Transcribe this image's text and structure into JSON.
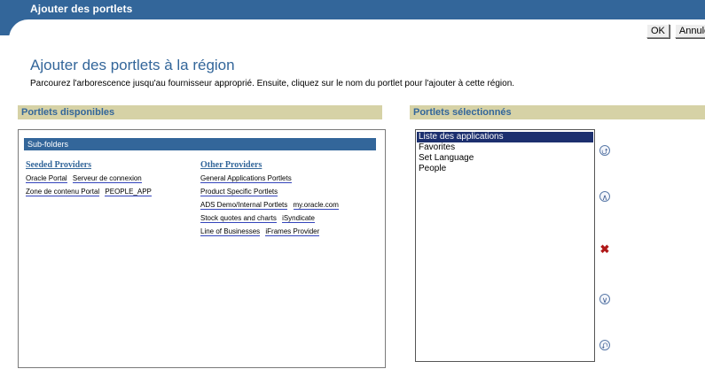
{
  "header": {
    "title": "Ajouter des portlets"
  },
  "toolbar": {
    "ok_label": "OK",
    "cancel_label": "Annule"
  },
  "page": {
    "title": "Ajouter des portlets à la région",
    "instructions": "Parcourez l'arborescence jusqu'au fournisseur approprié. Ensuite, cliquez sur le nom du portlet pour l'ajouter à cette région."
  },
  "available": {
    "header": "Portlets disponibles",
    "subfolders_label": "Sub-folders",
    "seeded": {
      "title": "Seeded Providers",
      "links": [
        "Oracle Portal",
        "Serveur de connexion",
        "Zone de contenu Portal",
        "PEOPLE_APP"
      ]
    },
    "other": {
      "title": "Other Providers",
      "links": [
        "General Applications Portlets",
        "Product Specific Portlets",
        "ADS Demo/Internal Portlets",
        "my.oracle.com",
        "Stock quotes and charts",
        "iSyndicate",
        "Line of Businesses",
        "iFrames Provider"
      ]
    }
  },
  "selected": {
    "header": "Portlets sélectionnés",
    "items": [
      "Liste des applications",
      "Favorites",
      "Set Language",
      "People"
    ],
    "selected_index": 0
  },
  "colors": {
    "header_bg": "#33669a",
    "section_bg": "#d6d2a6",
    "selection_bg": "#1c2f6e",
    "delete": "#b01818"
  },
  "icons": {
    "move_top": "double-chevron-up",
    "move_up": "chevron-up",
    "delete": "x-mark",
    "move_down": "chevron-down",
    "move_bottom": "double-chevron-down"
  }
}
